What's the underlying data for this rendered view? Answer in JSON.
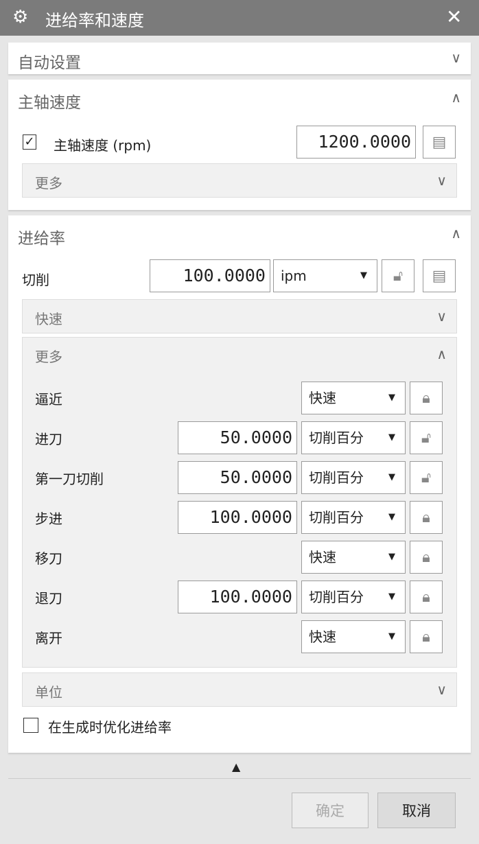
{
  "window": {
    "title": "进给率和速度",
    "close": "✕"
  },
  "auto": {
    "title": "自动设置"
  },
  "spindle": {
    "title": "主轴速度",
    "checkbox_label": "主轴速度 (rpm)",
    "checked": true,
    "value": "1200.0000",
    "more": "更多"
  },
  "feed": {
    "title": "进给率",
    "cut_label": "切削",
    "cut_value": "100.0000",
    "cut_unit": "ipm",
    "rapid": "快速",
    "more": "更多",
    "rows": [
      {
        "label": "逼近",
        "value": "",
        "mode": "快速",
        "locked": true
      },
      {
        "label": "进刀",
        "value": "50.0000",
        "mode": "切削百分",
        "locked": false
      },
      {
        "label": "第一刀切削",
        "value": "50.0000",
        "mode": "切削百分",
        "locked": false
      },
      {
        "label": "步进",
        "value": "100.0000",
        "mode": "切削百分",
        "locked": true
      },
      {
        "label": "移刀",
        "value": "",
        "mode": "快速",
        "locked": true
      },
      {
        "label": "退刀",
        "value": "100.0000",
        "mode": "切削百分",
        "locked": true
      },
      {
        "label": "离开",
        "value": "",
        "mode": "快速",
        "locked": true
      }
    ],
    "units": "单位",
    "optimize_label": "在生成时优化进给率",
    "optimize_checked": false
  },
  "footer": {
    "ok": "确定",
    "cancel": "取消"
  }
}
